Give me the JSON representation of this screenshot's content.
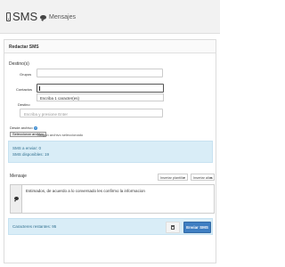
{
  "header": {
    "icon": "mobile-phone-icon",
    "title": "SMS",
    "subtitle_icon": "comment-icon",
    "subtitle": "Mensajes"
  },
  "panel": {
    "title": "Redactar SMS"
  },
  "recipients": {
    "section_label": "Destino(s)",
    "groups_label": "Grupos",
    "groups_value": "",
    "contacts_label": "Contactos",
    "contacts_value": "",
    "contacts_dropdown_hint": "Escriba 1 caracter(es)",
    "destination_label": "Destino",
    "destination_value": "",
    "destination_placeholder": "Escriba y presione Enter"
  },
  "attachment": {
    "label": "Desde archivo",
    "help_icon": "question-circle-icon",
    "button_label": "Seleccionar archivo",
    "status": "Ningún archivo seleccionado"
  },
  "sms_info": {
    "sent_line": "SMS a enviar: 0",
    "available_line": "SMS disponibles: 19"
  },
  "message": {
    "label": "Mensaje",
    "insert_template": "Insertar plantilla",
    "insert_alias": "Insertar alias",
    "side_icon": "comment-icon",
    "text": "Estimados, de acuerdo a lo conversado les confirmo la informacion"
  },
  "chars_info": {
    "remaining_line": "Caracteres restantes: 95"
  },
  "actions": {
    "delete_icon": "trash-icon",
    "send_label": "Enviar SMS"
  },
  "colors": {
    "info_bg": "#d9edf7",
    "info_text": "#31708f",
    "primary": "#3e7ec2"
  }
}
